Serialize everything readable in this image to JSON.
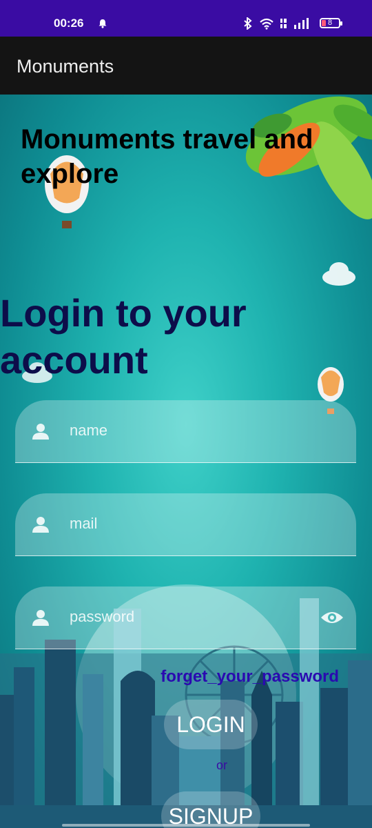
{
  "status_bar": {
    "time": "00:26",
    "battery": "8",
    "icons": [
      "bell-icon",
      "bluetooth-icon",
      "wifi-icon",
      "volte-icon",
      "signal-icon",
      "battery-icon"
    ]
  },
  "app_bar": {
    "title": "Monuments"
  },
  "main": {
    "tagline": "Monuments travel and explore",
    "heading": "Login to your account",
    "fields": {
      "name": {
        "placeholder": "name"
      },
      "mail": {
        "placeholder": "mail"
      },
      "password": {
        "placeholder": "password"
      }
    },
    "forget_link": "forget_your_password",
    "login_label": "LOGIN",
    "or_label": "or",
    "signup_label": "SIGNUP"
  },
  "colors": {
    "status_bar": "#3a0ca3",
    "app_bar": "#141414",
    "background_teal": "#1fb3b0",
    "heading": "#0d0d4a",
    "link": "#2a0ab0"
  }
}
